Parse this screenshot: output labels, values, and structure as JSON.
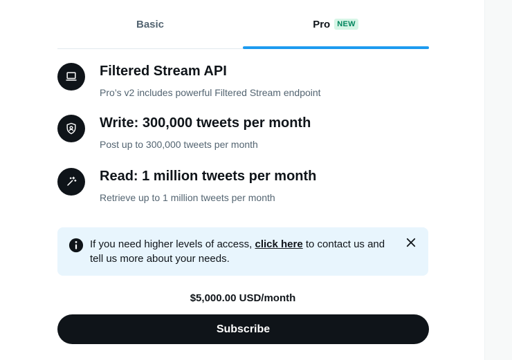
{
  "tabs": [
    {
      "label": "Basic"
    },
    {
      "label": "Pro",
      "badge": "NEW"
    }
  ],
  "features": [
    {
      "title": "Filtered Stream API",
      "description": "Pro’s v2 includes powerful Filtered Stream endpoint",
      "icon": "laptop-icon"
    },
    {
      "title": "Write: 300,000 tweets per month",
      "description": "Post up to 300,000 tweets per month",
      "icon": "shield-person-icon"
    },
    {
      "title": "Read: 1 million tweets per month",
      "description": "Retrieve up to 1 million tweets per month",
      "icon": "magic-wand-icon"
    }
  ],
  "notice": {
    "text_before": "If you need higher levels of access, ",
    "link_text": "click here",
    "text_after": " to contact us and tell us more about your needs."
  },
  "price": "$5,000.00 USD/month",
  "subscribe_label": "Subscribe",
  "colors": {
    "accent": "#1d9bf0",
    "dark": "#0f1419",
    "notice_bg": "#e8f5fd",
    "badge_bg": "#d6f5e6",
    "badge_text": "#00855d"
  }
}
